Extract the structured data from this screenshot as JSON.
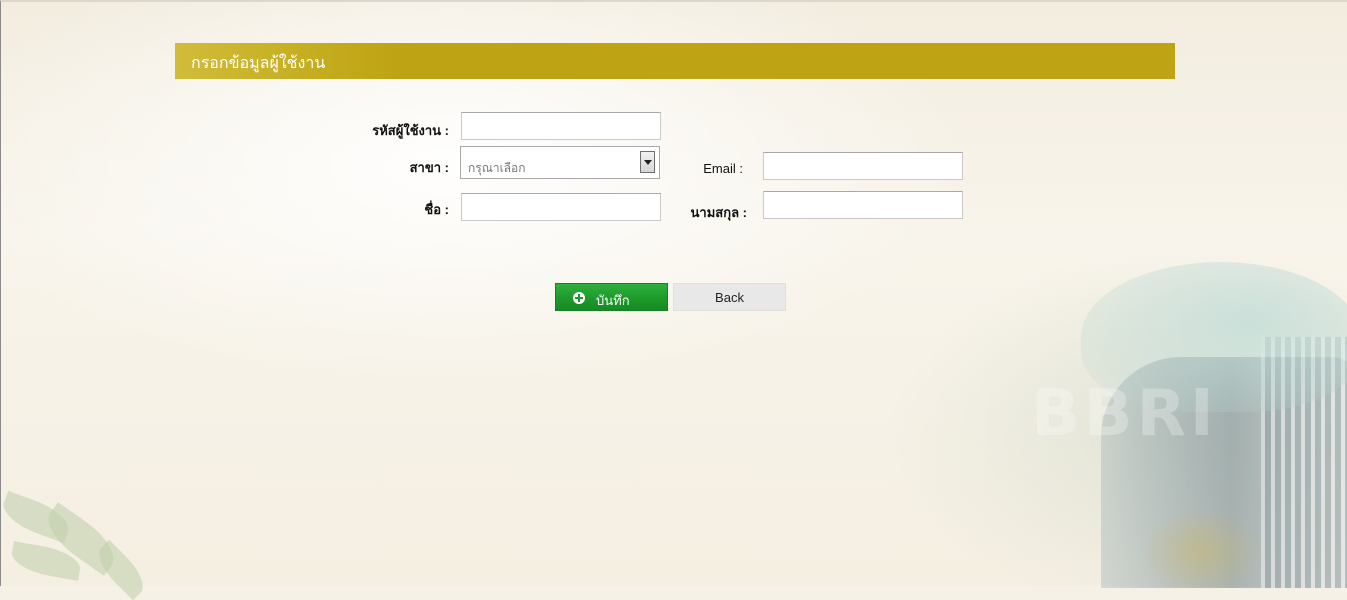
{
  "header": {
    "title": "กรอกข้อมูลผู้ใช้งาน"
  },
  "form": {
    "user_id": {
      "label": "รหัสผู้ใช้งาน :",
      "value": ""
    },
    "branch": {
      "label": "สาขา :",
      "selected": "กรุณาเลือก"
    },
    "email": {
      "label": "Email :",
      "value": ""
    },
    "first_name": {
      "label": "ชื่อ :",
      "value": ""
    },
    "last_name": {
      "label": "นามสกุล :",
      "value": ""
    }
  },
  "buttons": {
    "save_label": "บันทึก",
    "back_label": "Back"
  },
  "watermark": "BBRI",
  "colors": {
    "header_bar": "#bea415",
    "save_button": "#1d9a2b",
    "back_button": "#e8e8e8"
  }
}
